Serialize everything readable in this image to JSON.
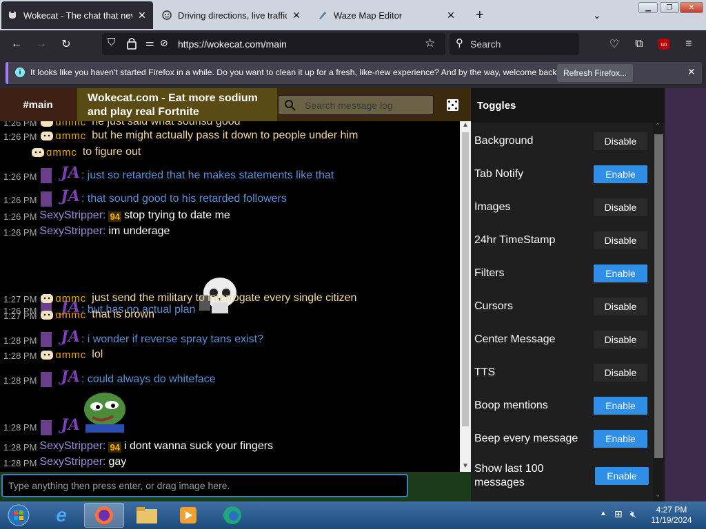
{
  "browser": {
    "tabs": [
      {
        "label": "Wokecat - The chat that never",
        "icon": "wokecat-tab-icon"
      },
      {
        "label": "Driving directions, live traffic &",
        "icon": "waze-tab-icon"
      },
      {
        "label": "Waze Map Editor",
        "icon": "map-editor-tab-icon"
      }
    ],
    "url": "https://wokecat.com/main",
    "search_placeholder": "Search",
    "extension_badge": "uo"
  },
  "notification": {
    "message": "It looks like you haven't started Firefox in a while. Do you want to clean it up for a fresh, like-new experience? And by the way, welcome back!",
    "button_label": "Refresh Firefox..."
  },
  "chat": {
    "room": "#main",
    "title_line1": "Wokecat.com - Eat more sodium",
    "title_line2": "and play real Fortnite",
    "search_placeholder": "Search message log",
    "input_placeholder": "Type anything then press enter, or drag image here.",
    "nick_amc": "ɑmmc",
    "nick_ja": "JA",
    "nick_sexy": "SexyStripper:",
    "emoji94": "94",
    "messages": [
      {
        "time": "1:26 PM",
        "nick": "amc",
        "text": "he just said what sounsd good"
      },
      {
        "time": "1:26 PM",
        "nick": "amc",
        "text": "but he might actually pass it down to people under him"
      },
      {
        "time": "",
        "nick": "amc",
        "text": "to figure out"
      },
      {
        "time": "1:26 PM",
        "nick": "ja",
        "text": ": just so retarded that he makes statements like that"
      },
      {
        "time": "1:26 PM",
        "nick": "ja",
        "text": ": that sound good to his retarded followers"
      },
      {
        "time": "1:26 PM",
        "nick": "sexy",
        "text": "stop trying to date me"
      },
      {
        "time": "1:26 PM",
        "nick": "sexy",
        "text": "im underage"
      },
      {
        "time": "1:26 PM",
        "nick": "ja",
        "text": ": but has no actual plan"
      },
      {
        "time": "1:27 PM",
        "nick": "amc",
        "text": "just send the military to interrogate every single citizen"
      },
      {
        "time": "1:27 PM",
        "nick": "amc",
        "text": "that is brown"
      },
      {
        "time": "1:28 PM",
        "nick": "ja",
        "text": ": i wonder if reverse spray tans exist?"
      },
      {
        "time": "1:28 PM",
        "nick": "amc",
        "text": "lol"
      },
      {
        "time": "1:28 PM",
        "nick": "ja",
        "text": ": could always do whiteface"
      },
      {
        "time": "1:28 PM",
        "nick": "ja",
        "text": ""
      },
      {
        "time": "1:28 PM",
        "nick": "sexy",
        "text": "i dont wanna suck your fingers"
      },
      {
        "time": "1:28 PM",
        "nick": "sexy",
        "text": "gay"
      }
    ]
  },
  "toggles": {
    "header": "Toggles",
    "items": [
      {
        "label": "Background",
        "button": "Disable"
      },
      {
        "label": "Tab Notify",
        "button": "Enable"
      },
      {
        "label": "Images",
        "button": "Disable"
      },
      {
        "label": "24hr TimeStamp",
        "button": "Disable"
      },
      {
        "label": "Filters",
        "button": "Enable"
      },
      {
        "label": "Cursors",
        "button": "Disable"
      },
      {
        "label": "Center Message",
        "button": "Disable"
      },
      {
        "label": "TTS",
        "button": "Disable"
      },
      {
        "label": "Boop mentions",
        "button": "Enable"
      },
      {
        "label": "Beep every message",
        "button": "Enable"
      },
      {
        "label": "Show last 100 messages",
        "button": "Enable"
      }
    ]
  },
  "taskbar": {
    "time": "4:27 PM",
    "date": "11/19/2024"
  },
  "colors": {
    "enable_button": "#2f8fe6",
    "disable_button": "#2a2a2a",
    "ja_nick": "#7b3fb8",
    "amc_nick": "#e8a600"
  }
}
